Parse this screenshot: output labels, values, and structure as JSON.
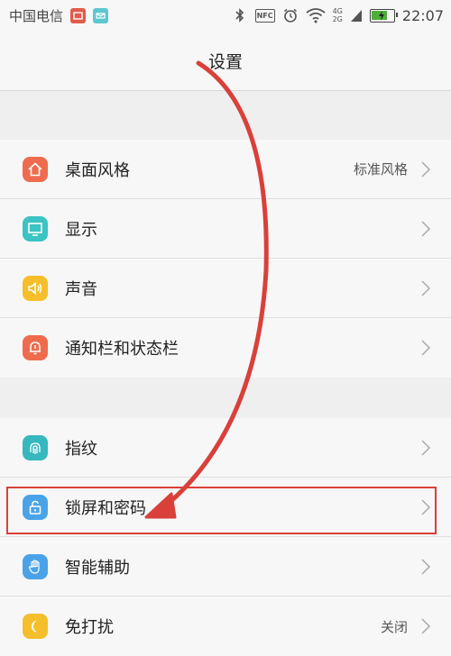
{
  "status_bar": {
    "carrier": "中国电信",
    "time": "22:07",
    "nfc_label": "NFC",
    "network_top": "4G",
    "network_bottom": "2G",
    "icons": [
      "notification-app-icon",
      "notification-sms-icon",
      "bluetooth-icon",
      "nfc-icon",
      "alarm-icon",
      "wifi-icon",
      "signal-icon",
      "battery-charging-icon"
    ]
  },
  "header": {
    "title": "设置"
  },
  "settings": {
    "group1": [
      {
        "label": "桌面风格",
        "value": "标准风格",
        "icon": "home-icon",
        "color": "#ee6b4e"
      },
      {
        "label": "显示",
        "value": "",
        "icon": "display-icon",
        "color": "#3cc3c3"
      },
      {
        "label": "声音",
        "value": "",
        "icon": "speaker-icon",
        "color": "#f5be2b"
      },
      {
        "label": "通知栏和状态栏",
        "value": "",
        "icon": "notification-bell-icon",
        "color": "#ee6b4e"
      }
    ],
    "group2": [
      {
        "label": "指纹",
        "value": "",
        "icon": "fingerprint-icon",
        "color": "#37b8bf"
      },
      {
        "label": "锁屏和密码",
        "value": "",
        "icon": "lock-icon",
        "color": "#4aa3e8",
        "highlighted": true
      },
      {
        "label": "智能辅助",
        "value": "",
        "icon": "hand-icon",
        "color": "#4aa3e8"
      },
      {
        "label": "免打扰",
        "value": "关闭",
        "icon": "moon-icon",
        "color": "#f5be2b"
      }
    ]
  },
  "colors": {
    "annotation": "#d9403a",
    "background": "#efefef",
    "surface": "#f7f7f7"
  }
}
